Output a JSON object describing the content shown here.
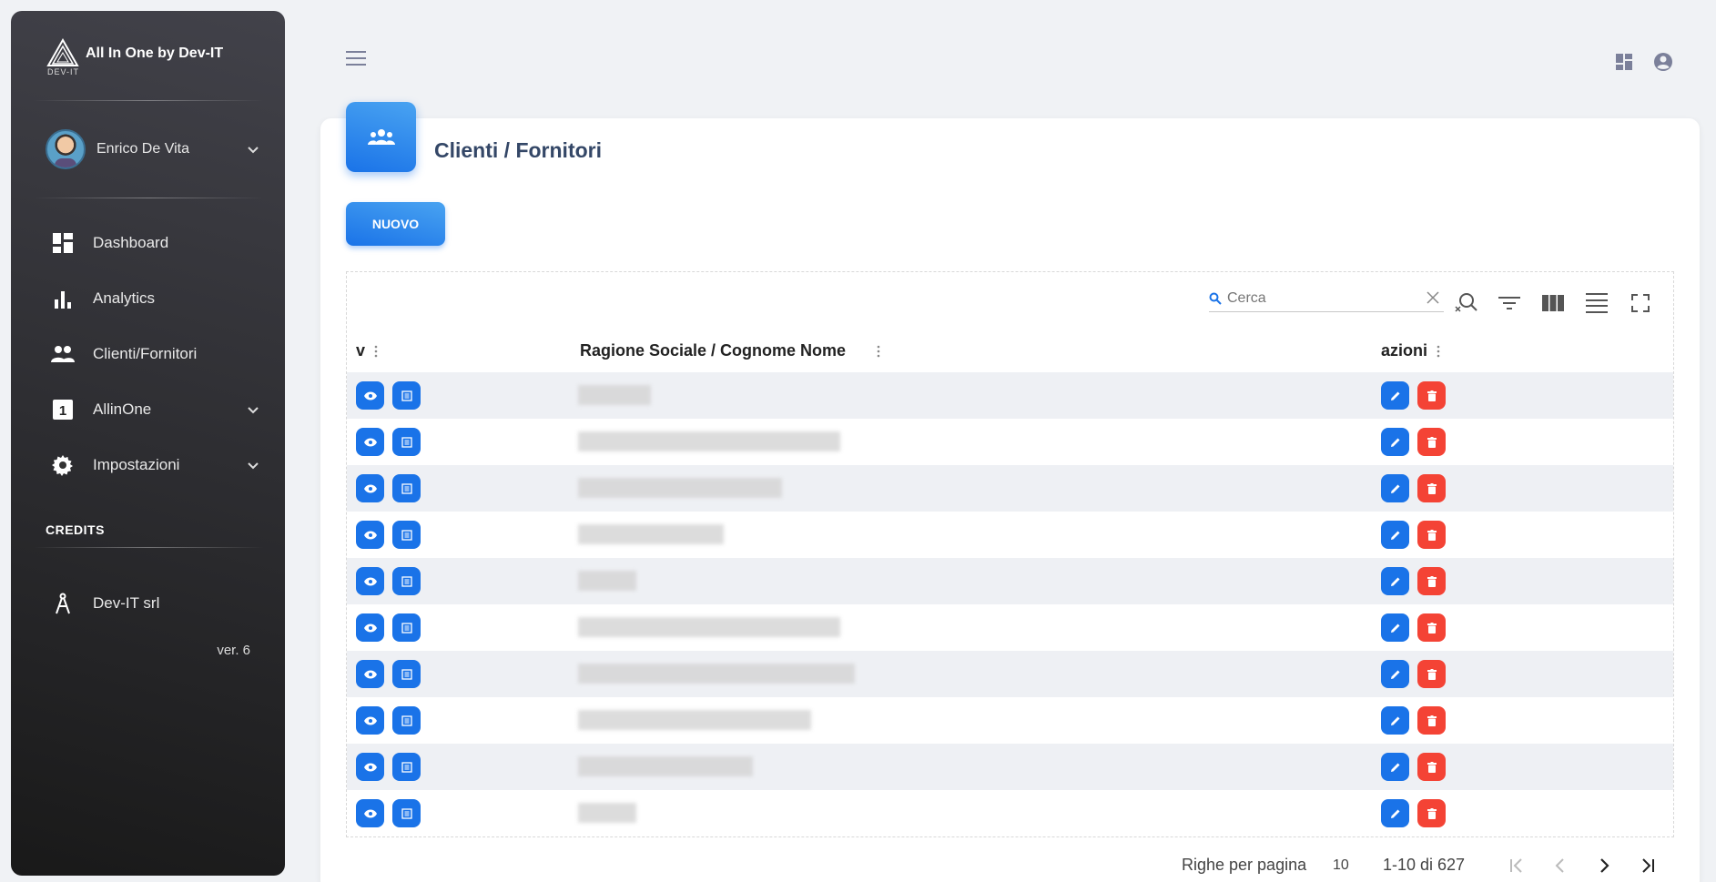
{
  "app": {
    "title": "All In One by Dev-IT",
    "logo_text": "DEV-IT"
  },
  "user": {
    "name": "Enrico De Vita"
  },
  "sidebar": {
    "items": [
      {
        "label": "Dashboard",
        "icon": "dashboard-icon"
      },
      {
        "label": "Analytics",
        "icon": "bar-chart-icon"
      },
      {
        "label": "Clienti/Fornitori",
        "icon": "people-icon"
      },
      {
        "label": "AllinOne",
        "icon": "one-square-icon"
      },
      {
        "label": "Impostazioni",
        "icon": "gear-icon"
      }
    ],
    "credits_heading": "CREDITS",
    "credits_item": "Dev-IT srl",
    "version": "ver. 6"
  },
  "page": {
    "title": "Clienti / Fornitori",
    "new_button": "NUOVO"
  },
  "table": {
    "search_placeholder": "Cerca",
    "columns": [
      "v",
      "Ragione Sociale / Cognome Nome",
      "azioni"
    ],
    "row_count_visible": 10,
    "rows_per_page_label": "Righe per pagina",
    "rows_per_page": "10",
    "range": "1-10 di 627"
  },
  "colors": {
    "primary": "#1a73e8",
    "danger": "#f44335",
    "sidebar_dark": "#191919"
  }
}
